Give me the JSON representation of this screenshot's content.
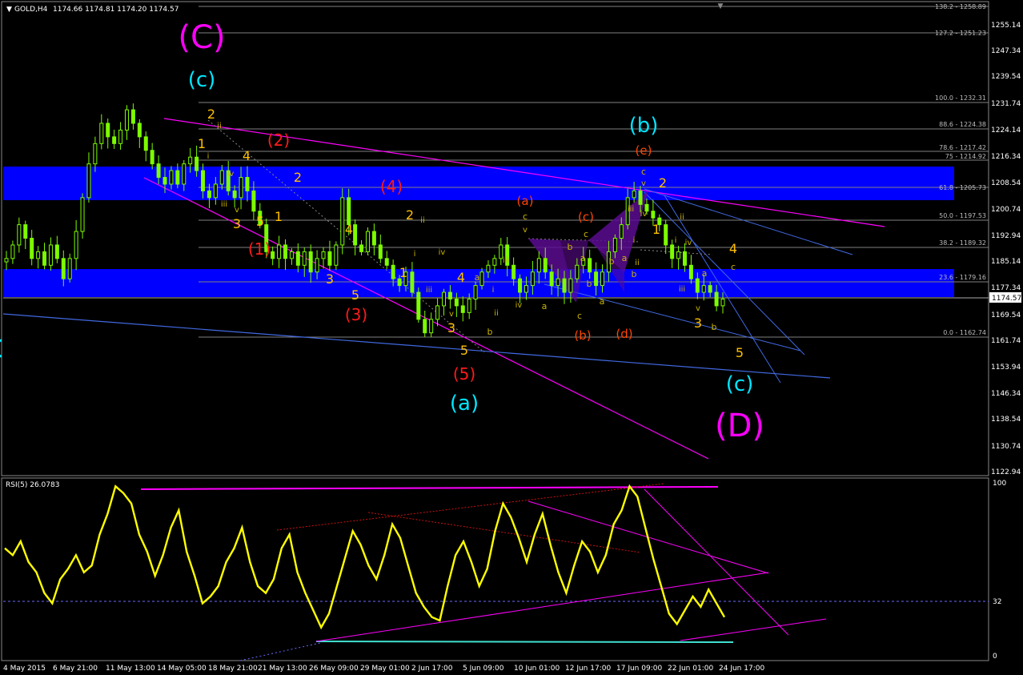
{
  "header": {
    "title": "GOLD,H4",
    "ohlc": "1174.66 1174.81 1174.20 1174.57",
    "rsi_title": "RSI(5) 26.0783"
  },
  "colors": {
    "background": "#000000",
    "candles": "#7CFC00",
    "rsi_line": "#FFFF00",
    "channel_magenta": "#FF00FF",
    "zone_blue": "#0000FF",
    "trend_blue": "#4169E1",
    "fib_gray": "#808080",
    "wave_cyan": "#00E5FF",
    "wave_magenta": "#FF00FF",
    "wave_red": "#FF1A1A",
    "wave_orange": "#FFA500",
    "wave_gold": "#FFC000",
    "wave_orange_red": "#FF4500",
    "wave_olive": "#C8B400",
    "pattern_purple": "#6A0DAD"
  },
  "price_axis": {
    "ticks": [
      "1255.14",
      "1247.34",
      "1239.54",
      "1231.74",
      "1224.14",
      "1216.34",
      "1208.54",
      "1200.74",
      "1192.94",
      "1185.14",
      "1177.34",
      "1169.54",
      "1161.74",
      "1153.94",
      "1146.34",
      "1138.54",
      "1130.74",
      "1122.94"
    ],
    "current_price": "1174.57"
  },
  "rsi_axis": {
    "ticks": [
      "100",
      "32",
      "0"
    ]
  },
  "time_axis": {
    "labels": [
      "4 May 2015",
      "6 May 21:00",
      "11 May 13:00",
      "14 May 05:00",
      "18 May 21:00",
      "21 May 13:00",
      "26 May 09:00",
      "29 May 01:00",
      "2 Jun 17:00",
      "5 Jun 09:00",
      "10 Jun 01:00",
      "12 Jun 17:00",
      "17 Jun 09:00",
      "22 Jun 01:00",
      "24 Jun 17:00"
    ]
  },
  "fib_levels": [
    "138.2 - 1258.89",
    "127.2 - 1251.23",
    "100.0 - 1232.31",
    "88.6 - 1224.38",
    "78.6 - 1217.42",
    "75 - 1214.92",
    "61.8 - 1205.73",
    "50.0 - 1197.53",
    "38.2 - 1189.32",
    "23.6 - 1179.16",
    "0.0 - 1162.74"
  ],
  "wave_labels": {
    "big_C": "(C)",
    "big_D": "(D)",
    "c_top": "(c)",
    "c_bottom": "(c)",
    "a_paren": "(a)",
    "b_paren": "(b)",
    "e_paren": "(e)",
    "w1": "(1)",
    "w2": "(2)",
    "w3": "(3)",
    "w4": "(4)",
    "w5": "(5)",
    "a_small": "(a)",
    "b_small": "(b)",
    "c_small": "(c)",
    "d_small": "(d)",
    "n1": "1",
    "n2": "2",
    "n3": "3",
    "n4": "4",
    "n5": "5",
    "r1": "i",
    "r2": "ii",
    "r3": "iii",
    "r4": "iv",
    "r5": "v",
    "la": "a",
    "lb": "b",
    "lc": "c"
  },
  "chart_data": {
    "type": "candlestick",
    "instrument": "GOLD",
    "timeframe": "H4",
    "close_path": [
      1186,
      1190,
      1196,
      1192,
      1186,
      1188,
      1184,
      1190,
      1186,
      1180,
      1186,
      1194,
      1204,
      1214,
      1220,
      1226,
      1222,
      1220,
      1224,
      1230,
      1226,
      1222,
      1218,
      1214,
      1210,
      1208,
      1212,
      1208,
      1214,
      1216,
      1212,
      1206,
      1204,
      1208,
      1212,
      1206,
      1204,
      1210,
      1206,
      1200,
      1196,
      1188,
      1186,
      1190,
      1186,
      1188,
      1184,
      1188,
      1182,
      1186,
      1188,
      1184,
      1190,
      1204,
      1196,
      1190,
      1188,
      1194,
      1190,
      1186,
      1184,
      1180,
      1178,
      1182,
      1176,
      1168,
      1164,
      1168,
      1172,
      1176,
      1174,
      1172,
      1170,
      1174,
      1178,
      1182,
      1184,
      1186,
      1190,
      1184,
      1180,
      1176,
      1178,
      1182,
      1186,
      1182,
      1178,
      1180,
      1176,
      1180,
      1184,
      1186,
      1182,
      1178,
      1182,
      1188,
      1192,
      1196,
      1204,
      1206,
      1202,
      1200,
      1198,
      1196,
      1190,
      1186,
      1188,
      1184,
      1180,
      1176,
      1178,
      1176,
      1172,
      1174
    ],
    "rsi": {
      "name": "RSI(5)",
      "current": 26.0783,
      "ylim": [
        0,
        100
      ],
      "level": 32,
      "values": [
        62,
        58,
        66,
        54,
        48,
        36,
        30,
        44,
        50,
        58,
        48,
        52,
        70,
        82,
        98,
        94,
        88,
        70,
        60,
        46,
        58,
        74,
        84,
        60,
        46,
        30,
        34,
        40,
        54,
        62,
        74,
        54,
        40,
        36,
        44,
        62,
        70,
        48,
        36,
        26,
        16,
        24,
        40,
        56,
        72,
        64,
        52,
        44,
        58,
        76,
        68,
        52,
        36,
        28,
        22,
        20,
        40,
        58,
        66,
        54,
        40,
        50,
        72,
        88,
        80,
        68,
        54,
        70,
        82,
        64,
        48,
        36,
        52,
        66,
        60,
        48,
        58,
        76,
        84,
        98,
        92,
        74,
        56,
        40,
        24,
        18,
        26,
        34,
        28,
        38,
        30,
        22
      ]
    }
  }
}
